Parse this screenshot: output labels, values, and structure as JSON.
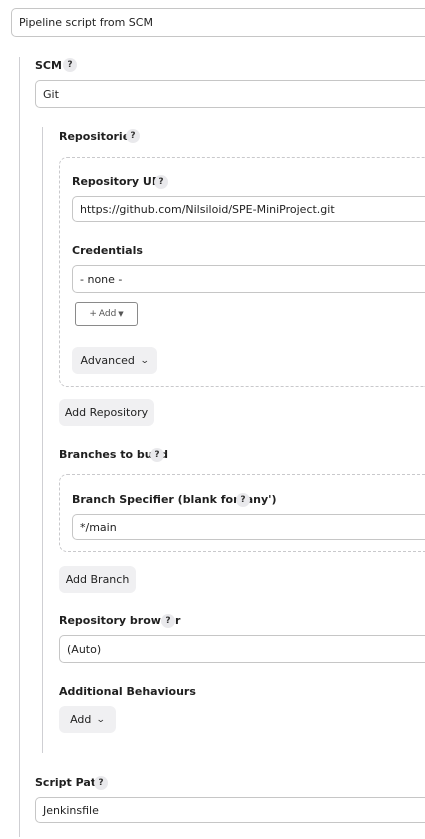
{
  "definition": {
    "selected": "Pipeline script from SCM"
  },
  "scm": {
    "label": "SCM",
    "selected": "Git",
    "repositories": {
      "label": "Repositories",
      "repository_url_label": "Repository URL",
      "repository_url_value": "https://github.com/Nilsiloid/SPE-MiniProject.git",
      "credentials_label": "Credentials",
      "credentials_selected": "- none -",
      "add_credentials_label": "Add",
      "advanced_label": "Advanced",
      "add_repository_label": "Add Repository"
    },
    "branches": {
      "label": "Branches to build",
      "specifier_label": "Branch Specifier (blank for 'any')",
      "specifier_value": "*/main",
      "add_branch_label": "Add Branch"
    },
    "repository_browser": {
      "label": "Repository browser",
      "selected": "(Auto)"
    },
    "additional_behaviours": {
      "label": "Additional Behaviours",
      "add_label": "Add"
    }
  },
  "script_path": {
    "label": "Script Path",
    "value": "Jenkinsfile"
  },
  "help_glyph": "?",
  "icons": {
    "help": "help-circle-icon",
    "chevron": "chevron-down-icon",
    "plus": "plus-icon",
    "caret": "caret-down-icon"
  }
}
